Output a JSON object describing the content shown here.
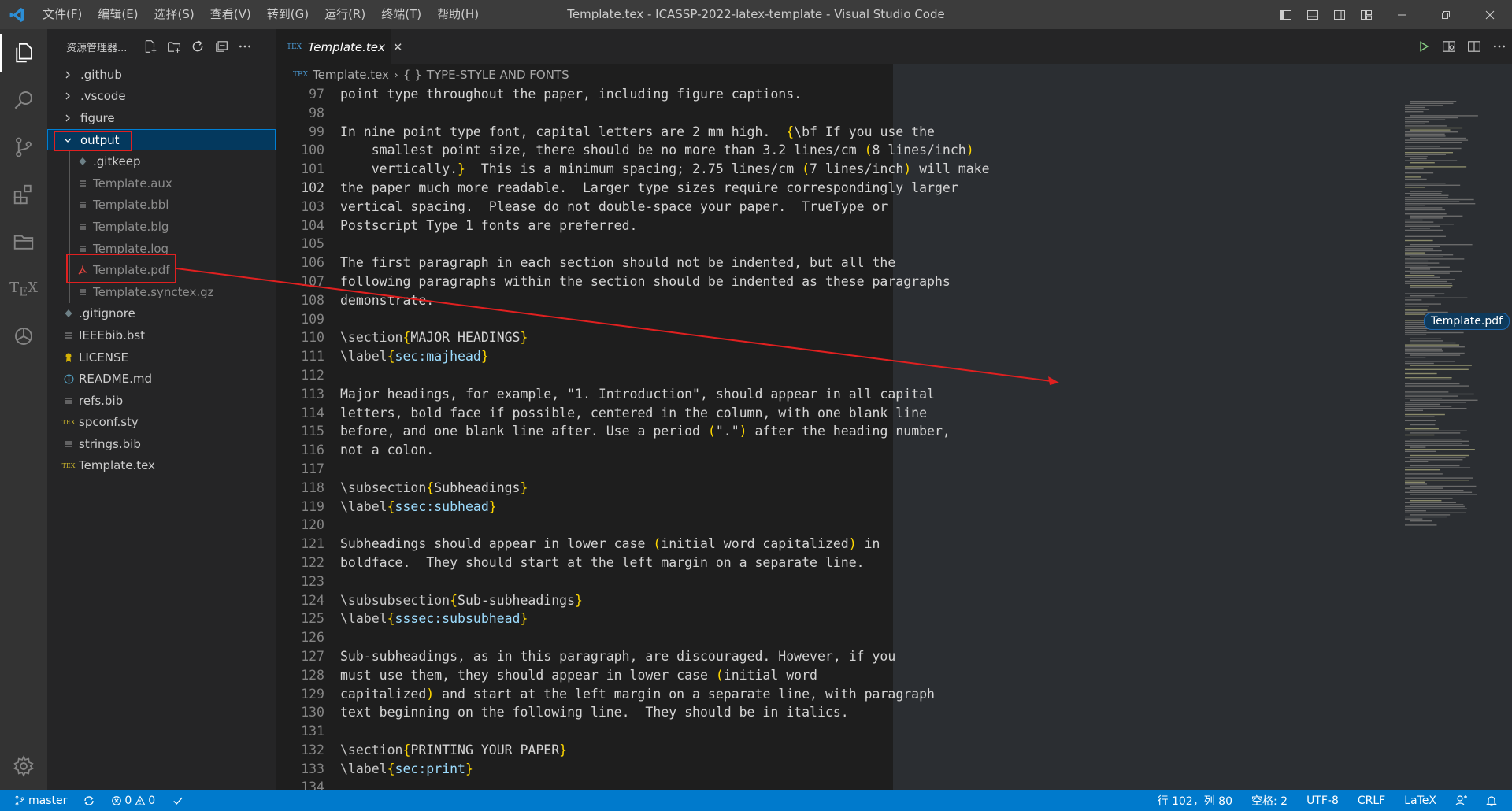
{
  "window": {
    "title": "Template.tex - ICASSP-2022-latex-template - Visual Studio Code"
  },
  "menu": [
    "文件(F)",
    "编辑(E)",
    "选择(S)",
    "查看(V)",
    "转到(G)",
    "运行(R)",
    "终端(T)",
    "帮助(H)"
  ],
  "sidebar": {
    "title": "资源管理器...",
    "items": [
      {
        "label": ".github",
        "kind": "folder-collapsed",
        "icon": "chevron-right-icon"
      },
      {
        "label": ".vscode",
        "kind": "folder-collapsed",
        "icon": "chevron-right-icon"
      },
      {
        "label": "figure",
        "kind": "folder-collapsed",
        "icon": "chevron-right-icon"
      },
      {
        "label": "output",
        "kind": "folder-expanded",
        "icon": "chevron-down-icon",
        "selected": true
      },
      {
        "label": ".gitkeep",
        "kind": "file",
        "icon": "gear-file-icon",
        "indent": 1
      },
      {
        "label": "Template.aux",
        "kind": "file",
        "icon": "lines-file-icon",
        "indent": 1,
        "dim": true
      },
      {
        "label": "Template.bbl",
        "kind": "file",
        "icon": "lines-file-icon",
        "indent": 1,
        "dim": true
      },
      {
        "label": "Template.blg",
        "kind": "file",
        "icon": "lines-file-icon",
        "indent": 1,
        "dim": true
      },
      {
        "label": "Template.log",
        "kind": "file",
        "icon": "lines-file-icon",
        "indent": 1,
        "dim": true
      },
      {
        "label": "Template.pdf",
        "kind": "file",
        "icon": "pdf-file-icon",
        "indent": 1,
        "dim": true
      },
      {
        "label": "Template.synctex.gz",
        "kind": "file",
        "icon": "lines-file-icon",
        "indent": 1,
        "dim": true
      },
      {
        "label": ".gitignore",
        "kind": "file",
        "icon": "gear-file-icon"
      },
      {
        "label": "IEEEbib.bst",
        "kind": "file",
        "icon": "lines-file-icon"
      },
      {
        "label": "LICENSE",
        "kind": "file",
        "icon": "license-file-icon"
      },
      {
        "label": "README.md",
        "kind": "file",
        "icon": "info-file-icon"
      },
      {
        "label": "refs.bib",
        "kind": "file",
        "icon": "lines-file-icon"
      },
      {
        "label": "spconf.sty",
        "kind": "file",
        "icon": "tex-file-icon"
      },
      {
        "label": "strings.bib",
        "kind": "file",
        "icon": "lines-file-icon"
      },
      {
        "label": "Template.tex",
        "kind": "file",
        "icon": "tex-file-icon"
      }
    ]
  },
  "tab": {
    "label": "Template.tex",
    "icon_text": "TEX"
  },
  "breadcrumb": {
    "file": "Template.tex",
    "symbol": "TYPE-STYLE AND FONTS",
    "symbol_icon": "{ }"
  },
  "editor": {
    "current_line": 102,
    "lines": [
      {
        "n": 97,
        "segs": [
          [
            "t",
            "point type throughout the paper, including figure captions."
          ]
        ]
      },
      {
        "n": 98,
        "segs": []
      },
      {
        "n": 99,
        "segs": [
          [
            "t",
            "In nine point type font, capital letters are 2 mm high.  "
          ],
          [
            "b",
            "{"
          ],
          [
            "t",
            "\\bf If you use the"
          ]
        ]
      },
      {
        "n": 100,
        "segs": [
          [
            "t",
            "    smallest point size, there should be no more than 3.2 lines/cm "
          ],
          [
            "b",
            "("
          ],
          [
            "t",
            "8 lines/inch"
          ],
          [
            "b",
            ")"
          ]
        ]
      },
      {
        "n": 101,
        "segs": [
          [
            "t",
            "    vertically."
          ],
          [
            "b",
            "}"
          ],
          [
            "t",
            "  This is a minimum spacing; 2.75 lines/cm "
          ],
          [
            "b",
            "("
          ],
          [
            "t",
            "7 lines/inch"
          ],
          [
            "b",
            ")"
          ],
          [
            "t",
            " will make"
          ]
        ]
      },
      {
        "n": 102,
        "segs": [
          [
            "t",
            "the paper much more readable.  Larger type sizes require correspondingly larger"
          ]
        ]
      },
      {
        "n": 103,
        "segs": [
          [
            "t",
            "vertical spacing.  Please do not double-space your paper.  TrueType or"
          ]
        ]
      },
      {
        "n": 104,
        "segs": [
          [
            "t",
            "Postscript Type 1 fonts are preferred."
          ]
        ]
      },
      {
        "n": 105,
        "segs": []
      },
      {
        "n": 106,
        "segs": [
          [
            "t",
            "The first paragraph in each section should not be indented, but all the"
          ]
        ]
      },
      {
        "n": 107,
        "segs": [
          [
            "t",
            "following paragraphs within the section should be indented as these paragraphs"
          ]
        ]
      },
      {
        "n": 108,
        "segs": [
          [
            "t",
            "demonstrate."
          ]
        ]
      },
      {
        "n": 109,
        "segs": []
      },
      {
        "n": 110,
        "segs": [
          [
            "k",
            "\\section"
          ],
          [
            "b",
            "{"
          ],
          [
            "t",
            "MAJOR HEADINGS"
          ],
          [
            "b",
            "}"
          ]
        ]
      },
      {
        "n": 111,
        "segs": [
          [
            "k",
            "\\label"
          ],
          [
            "b",
            "{"
          ],
          [
            "a",
            "sec:majhead"
          ],
          [
            "b",
            "}"
          ]
        ]
      },
      {
        "n": 112,
        "segs": []
      },
      {
        "n": 113,
        "segs": [
          [
            "t",
            "Major headings, for example, \"1. Introduction\", should appear in all capital"
          ]
        ]
      },
      {
        "n": 114,
        "segs": [
          [
            "t",
            "letters, bold face if possible, centered in the column, with one blank line"
          ]
        ]
      },
      {
        "n": 115,
        "segs": [
          [
            "t",
            "before, and one blank line after. Use a period "
          ],
          [
            "b",
            "("
          ],
          [
            "t",
            "\".\""
          ],
          [
            "b",
            ")"
          ],
          [
            "t",
            " after the heading number,"
          ]
        ]
      },
      {
        "n": 116,
        "segs": [
          [
            "t",
            "not a colon."
          ]
        ]
      },
      {
        "n": 117,
        "segs": []
      },
      {
        "n": 118,
        "segs": [
          [
            "k",
            "\\subsection"
          ],
          [
            "b",
            "{"
          ],
          [
            "t",
            "Subheadings"
          ],
          [
            "b",
            "}"
          ]
        ]
      },
      {
        "n": 119,
        "segs": [
          [
            "k",
            "\\label"
          ],
          [
            "b",
            "{"
          ],
          [
            "a",
            "ssec:subhead"
          ],
          [
            "b",
            "}"
          ]
        ]
      },
      {
        "n": 120,
        "segs": []
      },
      {
        "n": 121,
        "segs": [
          [
            "t",
            "Subheadings should appear in lower case "
          ],
          [
            "b",
            "("
          ],
          [
            "t",
            "initial word capitalized"
          ],
          [
            "b",
            ")"
          ],
          [
            "t",
            " in"
          ]
        ]
      },
      {
        "n": 122,
        "segs": [
          [
            "t",
            "boldface.  They should start at the left margin on a separate line."
          ]
        ]
      },
      {
        "n": 123,
        "segs": []
      },
      {
        "n": 124,
        "segs": [
          [
            "k",
            "\\subsubsection"
          ],
          [
            "b",
            "{"
          ],
          [
            "t",
            "Sub-subheadings"
          ],
          [
            "b",
            "}"
          ]
        ]
      },
      {
        "n": 125,
        "segs": [
          [
            "k",
            "\\label"
          ],
          [
            "b",
            "{"
          ],
          [
            "a",
            "sssec:subsubhead"
          ],
          [
            "b",
            "}"
          ]
        ]
      },
      {
        "n": 126,
        "segs": []
      },
      {
        "n": 127,
        "segs": [
          [
            "t",
            "Sub-subheadings, as in this paragraph, are discouraged. However, if you"
          ]
        ]
      },
      {
        "n": 128,
        "segs": [
          [
            "t",
            "must use them, they should appear in lower case "
          ],
          [
            "b",
            "("
          ],
          [
            "t",
            "initial word"
          ]
        ]
      },
      {
        "n": 129,
        "segs": [
          [
            "t",
            "capitalized"
          ],
          [
            "b",
            ")"
          ],
          [
            "t",
            " and start at the left margin on a separate line, with paragraph"
          ]
        ]
      },
      {
        "n": 130,
        "segs": [
          [
            "t",
            "text beginning on the following line.  They should be in italics."
          ]
        ]
      },
      {
        "n": 131,
        "segs": []
      },
      {
        "n": 132,
        "segs": [
          [
            "k",
            "\\section"
          ],
          [
            "b",
            "{"
          ],
          [
            "t",
            "PRINTING YOUR PAPER"
          ],
          [
            "b",
            "}"
          ]
        ]
      },
      {
        "n": 133,
        "segs": [
          [
            "k",
            "\\label"
          ],
          [
            "b",
            "{"
          ],
          [
            "a",
            "sec:print"
          ],
          [
            "b",
            "}"
          ]
        ]
      },
      {
        "n": 134,
        "segs": []
      }
    ]
  },
  "drag_label": "Template.pdf",
  "status": {
    "branch": "master",
    "errors": "0",
    "warnings": "0",
    "position": "行 102，列 80",
    "spaces": "空格: 2",
    "encoding": "UTF-8",
    "eol": "CRLF",
    "language": "LaTeX"
  },
  "colors": {
    "accent": "#007acc",
    "annotation": "#e02020",
    "selection": "#04395e"
  }
}
